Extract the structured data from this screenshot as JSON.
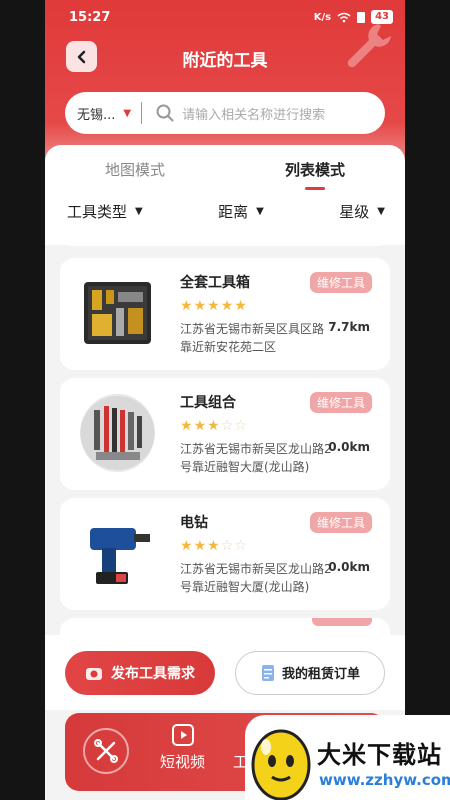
{
  "status_bar": {
    "time": "15:27",
    "speed": "K/s",
    "battery": "43"
  },
  "header": {
    "title": "附近的工具"
  },
  "search": {
    "city": "无锡...",
    "placeholder": "请输入相关名称进行搜索"
  },
  "tabs": [
    {
      "label": "地图模式",
      "active": false
    },
    {
      "label": "列表模式",
      "active": true
    }
  ],
  "filters": [
    {
      "label": "工具类型"
    },
    {
      "label": "距离"
    },
    {
      "label": "星级"
    }
  ],
  "tools": [
    {
      "name": "全套工具箱",
      "badge": "维修工具",
      "rating": 5,
      "address": "江苏省无锡市新吴区具区路靠近新安花苑二区",
      "distance": "7.7km"
    },
    {
      "name": "工具组合",
      "badge": "维修工具",
      "rating": 3,
      "address": "江苏省无锡市新吴区龙山路2号靠近融智大厦(龙山路)",
      "distance": "0.0km"
    },
    {
      "name": "电钻",
      "badge": "维修工具",
      "rating": 3,
      "address": "江苏省无锡市新吴区龙山路2号靠近融智大厦(龙山路)",
      "distance": "0.0km"
    }
  ],
  "actions": {
    "publish_label": "发布工具需求",
    "orders_label": "我的租赁订单"
  },
  "bottom_nav": [
    {
      "label": "短视频"
    },
    {
      "label": "工"
    }
  ],
  "watermark": {
    "title": "大米下载站",
    "url": "www.zzhyw.com"
  },
  "colors": {
    "primary": "#e03a3a",
    "badge": "#f0a6a6",
    "star": "#f6b83a"
  }
}
